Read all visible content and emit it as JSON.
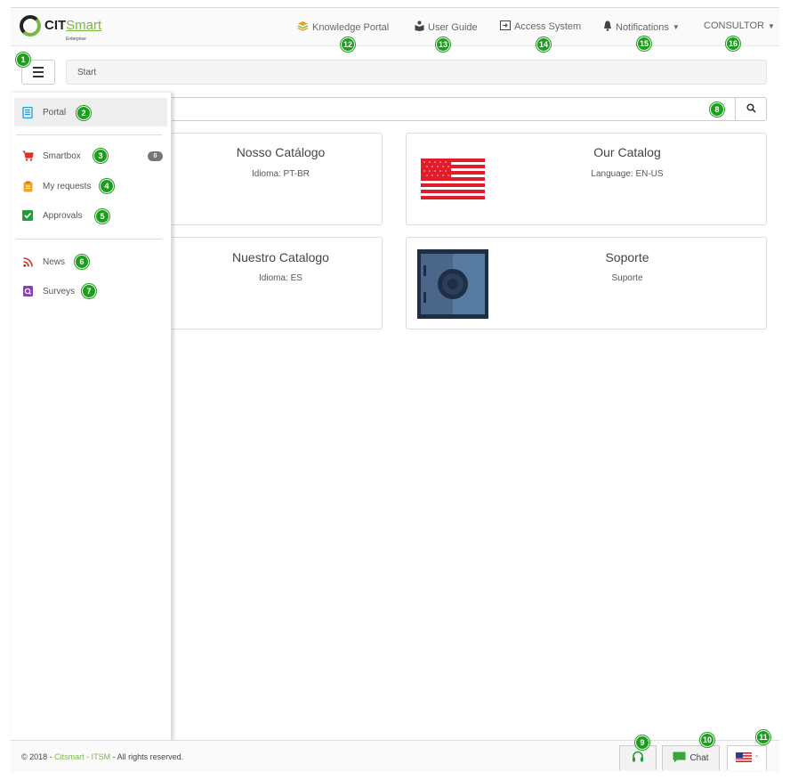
{
  "header": {
    "logo": {
      "brand_prefix": "CIT",
      "brand_suffix": "Smart",
      "tagline": "Enterprise"
    },
    "nav": {
      "knowledge_portal": "Knowledge Portal",
      "user_guide": "User Guide",
      "access_system": "Access System",
      "notifications": "Notifications",
      "user_menu": "CONSULTOR"
    }
  },
  "breadcrumb": {
    "current": "Start"
  },
  "search": {
    "value": "",
    "placeholder": ""
  },
  "sidebar": {
    "items": [
      {
        "label": "Portal"
      },
      {
        "label": "Smartbox",
        "count": "0"
      },
      {
        "label": "My requests"
      },
      {
        "label": "Approvals"
      },
      {
        "label": "News"
      },
      {
        "label": "Surveys"
      }
    ]
  },
  "catalogs": [
    {
      "title": "Nosso Catálogo",
      "subtitle": "Idioma: PT-BR"
    },
    {
      "title": "Our Catalog",
      "subtitle": "Language: EN-US"
    },
    {
      "title": "Nuestro Catalogo",
      "subtitle": "Idioma: ES"
    },
    {
      "title": "Soporte",
      "subtitle": "Suporte"
    }
  ],
  "footer": {
    "copyright": "© 2018 - ",
    "company": "Citsmart - ITSM",
    "rights": " - All rights reserved.",
    "chat_label": "Chat"
  },
  "annotations": [
    "1",
    "2",
    "3",
    "4",
    "5",
    "6",
    "7",
    "8",
    "9",
    "10",
    "11",
    "12",
    "13",
    "14",
    "15",
    "16"
  ],
  "colors": {
    "accent": "#7ab648",
    "badge": "#1e9e1e",
    "flag_red": "#e21d2a",
    "safe_blue": "#4a6789"
  }
}
